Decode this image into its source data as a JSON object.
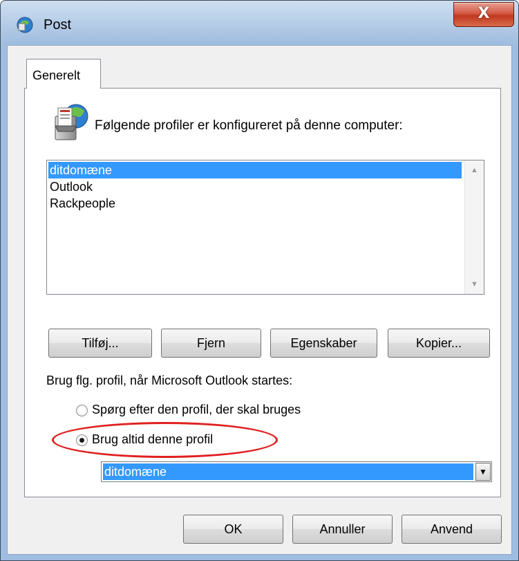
{
  "window": {
    "title": "Post",
    "close_glyph": "X",
    "icon": "mail-settings-icon"
  },
  "tabs": [
    {
      "label": "Generelt",
      "active": true
    }
  ],
  "panel": {
    "heading": "Følgende profiler er konfigureret på denne computer:",
    "profiles": [
      {
        "name": "ditdomæne",
        "selected": true
      },
      {
        "name": "Outlook",
        "selected": false
      },
      {
        "name": "Rackpeople",
        "selected": false
      }
    ],
    "buttons": {
      "add": "Tilføj...",
      "remove": "Fjern",
      "properties": "Egenskaber",
      "copy": "Kopier..."
    },
    "startup_label": "Brug flg. profil, når Microsoft Outlook startes:",
    "radio_prompt": "Spørg efter den profil, der skal bruges",
    "radio_always": "Brug altid denne profil",
    "selected_option": "always",
    "profile_select": {
      "value": "ditdomæne"
    }
  },
  "footer": {
    "ok": "OK",
    "cancel": "Annuller",
    "apply": "Anvend"
  },
  "colors": {
    "selection": "#3399ff",
    "annotation": "#e02020",
    "titlebar": "#bcd2ea"
  }
}
